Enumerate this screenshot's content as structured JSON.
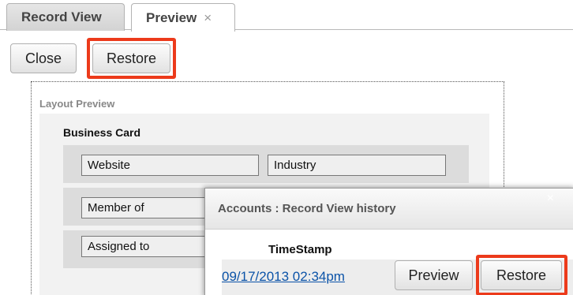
{
  "tabs": {
    "record_view": "Record View",
    "preview": "Preview",
    "preview_close": "×"
  },
  "toolbar": {
    "close_label": "Close",
    "restore_label": "Restore"
  },
  "layout_preview": {
    "title": "Layout Preview",
    "panel_title": "Business Card",
    "fields": [
      "Website",
      "Industry",
      "Member of",
      "Assigned to"
    ]
  },
  "history_dialog": {
    "title": "Accounts : Record View history",
    "close": "×",
    "column_timestamp": "TimeStamp",
    "rows": [
      {
        "timestamp": "09/17/2013 02:34pm",
        "preview_label": "Preview",
        "restore_label": "Restore"
      }
    ]
  },
  "colors": {
    "highlight": "#ec3a1b",
    "link": "#0b53a8"
  }
}
